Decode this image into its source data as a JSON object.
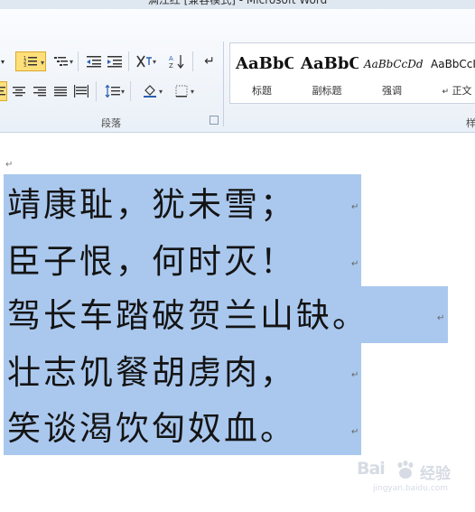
{
  "window": {
    "title": "满江红 [兼容模式] - Microsoft Word"
  },
  "paragraph_group": {
    "label": "段落"
  },
  "styles_group": {
    "label": "样",
    "items": [
      {
        "preview": "AaBbC",
        "name": "标题"
      },
      {
        "preview": "AaBbC",
        "name": "副标题"
      },
      {
        "preview": "AaBbCcDd",
        "name": "强调"
      },
      {
        "preview": "AaBbCcI",
        "name": "正文"
      }
    ]
  },
  "document": {
    "lines": [
      "靖康耻，犹未雪；",
      "臣子恨，何时灭！",
      "驾长车踏破贺兰山缺。",
      "壮志饥餐胡虏肉，",
      "笑谈渴饮匈奴血。"
    ],
    "paragraph_mark": "↵",
    "selection_color": "#aac8ee"
  },
  "watermark": {
    "brand": "Bai",
    "brand2": "经验",
    "url": "jingyan.baidu.com"
  }
}
